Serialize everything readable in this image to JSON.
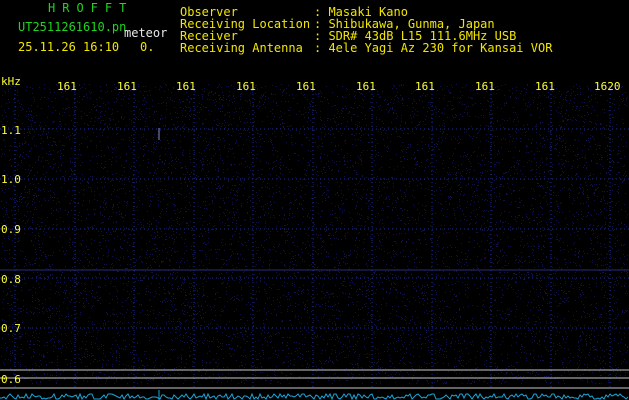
{
  "header": {
    "brand": "HROFFT",
    "filename": "UT2511261610.pn",
    "mode_label": "meteor",
    "datetime": "25.11.26 16:10",
    "count": "0.",
    "info": [
      {
        "label": "Observer",
        "value": ": Masaki Kano"
      },
      {
        "label": "Receiving Location",
        "value": ": Shibukawa, Gunma, Japan"
      },
      {
        "label": "Receiver",
        "value": ": SDR# 43dB L15 111.6MHz USB"
      },
      {
        "label": "Receiving Antenna",
        "value": ": 4ele Yagi Az 230 for Kansai VOR"
      }
    ]
  },
  "chart_data": {
    "type": "heatmap",
    "ylabel": "kHz",
    "y_ticks": [
      "1.1",
      "1.0",
      "0.9",
      "0.8",
      "0.7",
      "0.6"
    ],
    "x_ticks": [
      "161",
      "161",
      "161",
      "161",
      "161",
      "161",
      "161",
      "161",
      "161",
      "1620"
    ],
    "grid": true,
    "colors": {
      "background": "#000000",
      "grid": "#1c2e9a",
      "noise": "#12124a",
      "baseline": "#1aa6d8",
      "hline": "#c8c8c8",
      "axis_text": "#ffff33"
    }
  }
}
